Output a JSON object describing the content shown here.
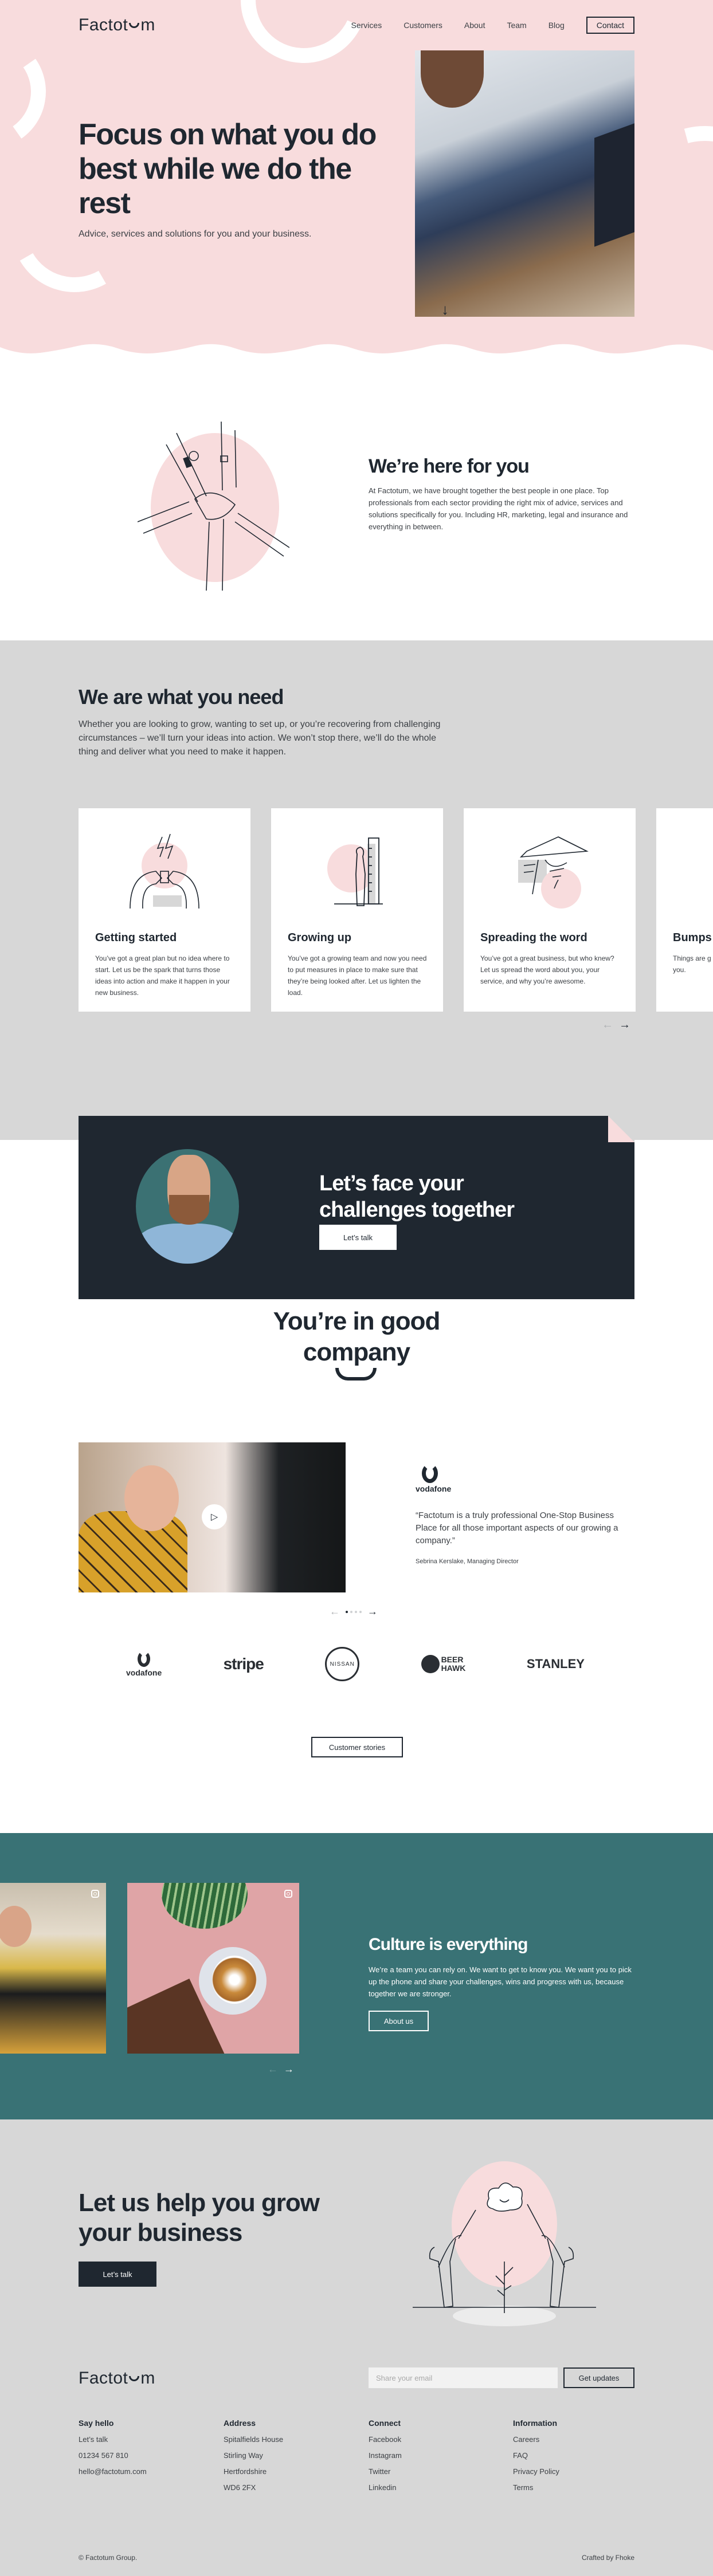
{
  "brand": {
    "logo_left": "Factot",
    "logo_right": "m"
  },
  "nav": {
    "links": [
      "Services",
      "Customers",
      "About",
      "Team",
      "Blog"
    ],
    "contact": "Contact"
  },
  "hero": {
    "title": "Focus on what you do best while we do the rest",
    "subtitle": "Advice, services and solutions for you and your business.",
    "scroll_icon": "↓"
  },
  "here": {
    "title": "We’re here for you",
    "text": "At Factotum, we have brought together the best people in one place. Top professionals from each sector providing the right mix of advice, services and solutions specifically for you. Including HR, marketing, legal and insurance and everything in between."
  },
  "services": {
    "title": "We are what you need",
    "text": "Whether you are looking to grow, wanting to set up, or you’re recovering from challenging circumstances – we’ll turn your ideas into action. We won’t stop there, we’ll do the whole thing and deliver what you need to make it happen.",
    "cards": [
      {
        "title": "Getting started",
        "text": "You’ve got a great plan but no idea where to start. Let us be the spark that turns those ideas into action and make it happen in your new business.",
        "icon": "spark-plug-icon"
      },
      {
        "title": "Growing up",
        "text": "You’ve got a growing team and now you need to put measures in place to make sure that they’re being looked after. Let us lighten the load.",
        "icon": "height-chart-icon"
      },
      {
        "title": "Spreading the word",
        "text": "You’ve got a great business, but who knew? Let us spread the word about you, your service, and why you’re awesome.",
        "icon": "paper-plane-icon"
      },
      {
        "title": "Bumps",
        "text": "Things are g to put meas business an guide you.",
        "icon": "gauge-icon"
      }
    ],
    "prev": "←",
    "next": "→"
  },
  "cta": {
    "title": "Let’s face your challenges together",
    "button": "Let’s talk"
  },
  "company": {
    "title": "You’re in good company",
    "testimonial": {
      "brand": "vodafone",
      "quote": "“Factotum is a truly professional One-Stop Business Place for all those important aspects of our growing a company.”",
      "author": "Sebrina Kerslake, Managing Director",
      "play": "▷",
      "slides": 4,
      "active_slide": 1
    },
    "prev": "←",
    "next": "→",
    "logos": [
      "vodafone",
      "stripe",
      "NISSAN",
      "BEER HAWK",
      "STANLEY"
    ],
    "button": "Customer stories"
  },
  "culture": {
    "title": "Culture is everything",
    "text": "We’re a team you can rely on. We want to get to know you. We want you to pick up the phone and share your challenges, wins and progress with us, because together we are stronger.",
    "button": "About us",
    "prev": "←",
    "next": "→"
  },
  "grow": {
    "title": "Let us help you grow your business",
    "button": "Let’s talk"
  },
  "footer": {
    "email_placeholder": "Share your email",
    "email_value": "",
    "updates_button": "Get updates",
    "columns": [
      {
        "heading": "Say hello",
        "items": [
          "Let’s talk",
          "01234 567 810",
          "hello@factotum.com"
        ]
      },
      {
        "heading": "Address",
        "items": [
          "Spitalfields House",
          "Stirling Way",
          "Hertfordshire",
          "WD6 2FX"
        ]
      },
      {
        "heading": "Connect",
        "items": [
          "Facebook",
          "Instagram",
          "Twitter",
          "Linkedin"
        ]
      },
      {
        "heading": "Information",
        "items": [
          "Careers",
          "FAQ",
          "Privacy Policy",
          "Terms"
        ]
      }
    ],
    "copyright": "© Factotum Group.",
    "credit": "Crafted by Fhoke"
  },
  "colors": {
    "pink": "#f8dcdd",
    "dark": "#1f2730",
    "grey": "#d7d7d7",
    "teal": "#397275"
  }
}
